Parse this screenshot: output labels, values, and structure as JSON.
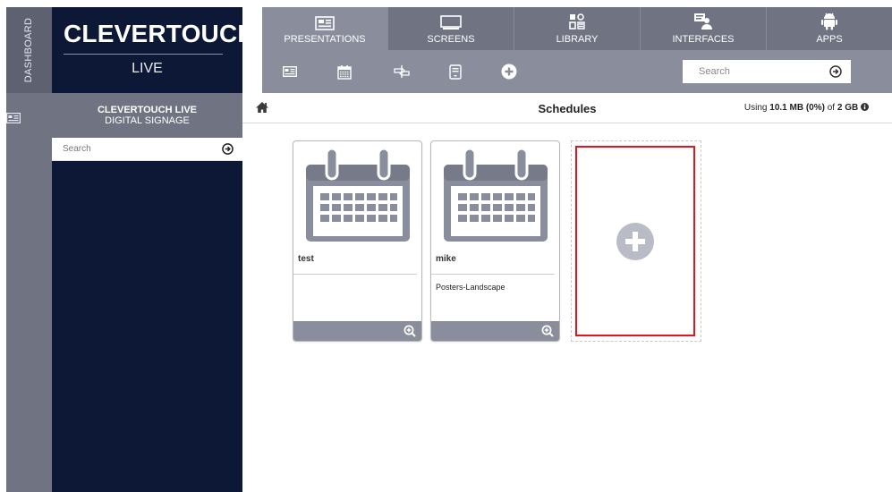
{
  "app": {
    "rail_label": "DASHBOARD",
    "brand_name": "CLEVERTOUCH",
    "brand_mark": "®",
    "brand_sub": "LIVE"
  },
  "sidebar": {
    "title": "CLEVERTOUCH LIVE",
    "subtitle": "DIGITAL SIGNAGE",
    "search_placeholder": "Search"
  },
  "nav": {
    "tabs": [
      {
        "label": "PRESENTATIONS",
        "icon": "presentation-icon",
        "active": true
      },
      {
        "label": "SCREENS",
        "icon": "monitor-icon",
        "active": false
      },
      {
        "label": "LIBRARY",
        "icon": "library-icon",
        "active": false
      },
      {
        "label": "INTERFACES",
        "icon": "interface-icon",
        "active": false
      },
      {
        "label": "APPS",
        "icon": "android-icon",
        "active": false
      }
    ],
    "tools": [
      "presentation-icon",
      "calendar-icon",
      "sign-icon",
      "tablet-icon",
      "add-circle-icon"
    ],
    "search_placeholder": "Search"
  },
  "content": {
    "title": "Schedules",
    "usage_prefix": "Using ",
    "usage_amount": "10.1 MB (0%)",
    "usage_mid": " of ",
    "usage_total": "2 GB",
    "cards": [
      {
        "name": "test",
        "description": ""
      },
      {
        "name": "mike",
        "description": "Posters-Landscape"
      }
    ]
  },
  "colors": {
    "navy": "#0d1837",
    "slate": "#6f7382",
    "slate_light": "#8a8e9c",
    "highlight": "#e0161c"
  }
}
